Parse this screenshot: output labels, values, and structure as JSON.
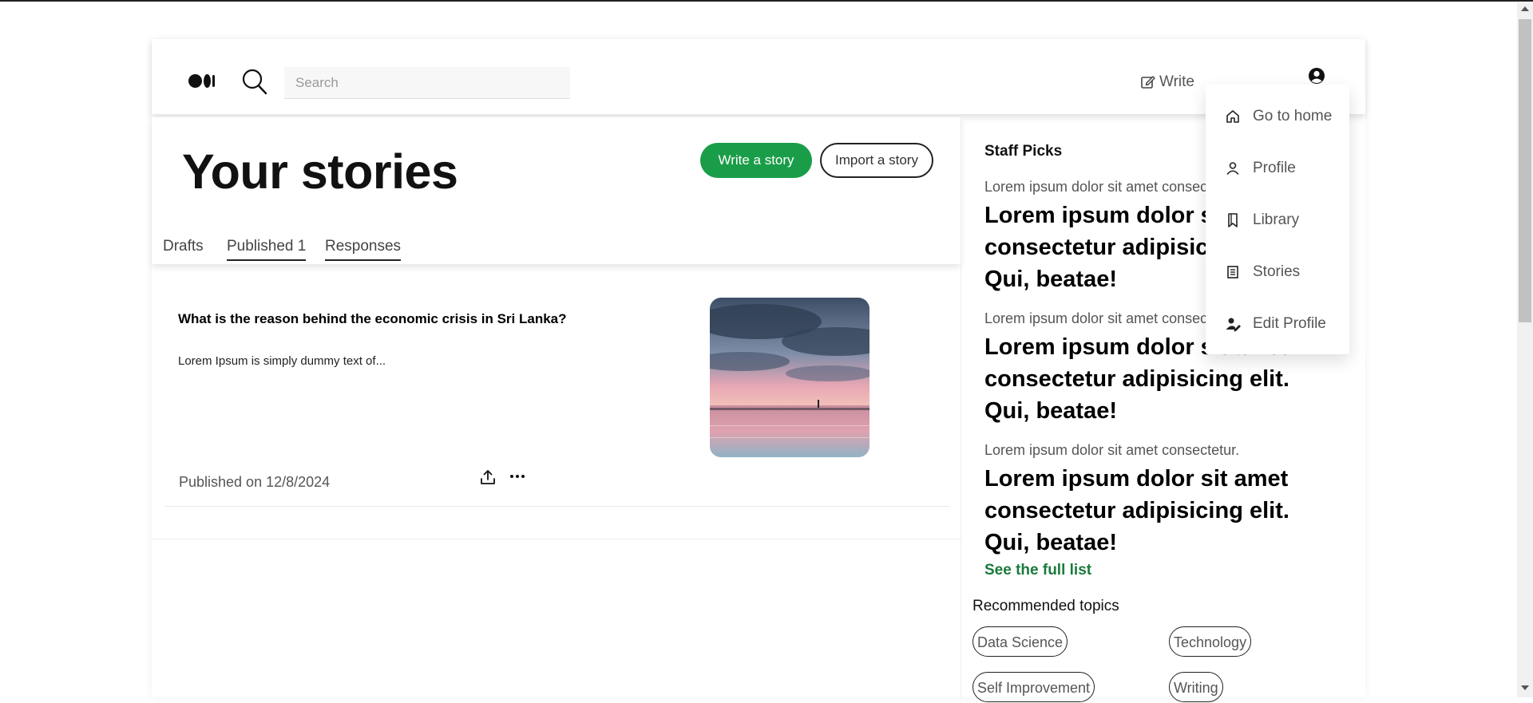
{
  "header": {
    "search_placeholder": "Search",
    "write_label": "Write"
  },
  "user_menu": {
    "items": [
      {
        "label": "Go to home",
        "icon": "home-icon"
      },
      {
        "label": "Profile",
        "icon": "user-icon"
      },
      {
        "label": "Library",
        "icon": "bookmark-icon"
      },
      {
        "label": "Stories",
        "icon": "document-icon"
      },
      {
        "label": "Edit Profile",
        "icon": "user-edit-icon"
      }
    ]
  },
  "main": {
    "title": "Your stories",
    "write_story_label": "Write a story",
    "import_story_label": "Import a story",
    "tabs": [
      {
        "label": "Drafts"
      },
      {
        "label": "Published 1"
      },
      {
        "label": "Responses"
      }
    ],
    "story": {
      "title": "What is the reason behind the economic crisis in Sri Lanka?",
      "excerpt": "Lorem Ipsum is simply dummy text of...",
      "date": "Published on 12/8/2024"
    }
  },
  "sidebar": {
    "staff_picks_heading": "Staff Picks",
    "picks": [
      {
        "author": "Lorem ipsum dolor sit amet consectetur.",
        "title": "Lorem ipsum dolor sit amet consectetur adipisicing elit. Qui, beatae!"
      },
      {
        "author": "Lorem ipsum dolor sit amet consectetur.",
        "title": "Lorem ipsum dolor sit amet consectetur adipisicing elit. Qui, beatae!"
      },
      {
        "author": "Lorem ipsum dolor sit amet consectetur.",
        "title": "Lorem ipsum dolor sit amet consectetur adipisicing elit. Qui, beatae!"
      }
    ],
    "see_full_list": "See the full list",
    "recommended_heading": "Recommended topics",
    "topics": [
      "Data Science",
      "Technology",
      "Self Improvement",
      "Writing"
    ]
  },
  "colors": {
    "accent_green": "#1a9d48",
    "link_green": "#1a7a3c"
  }
}
